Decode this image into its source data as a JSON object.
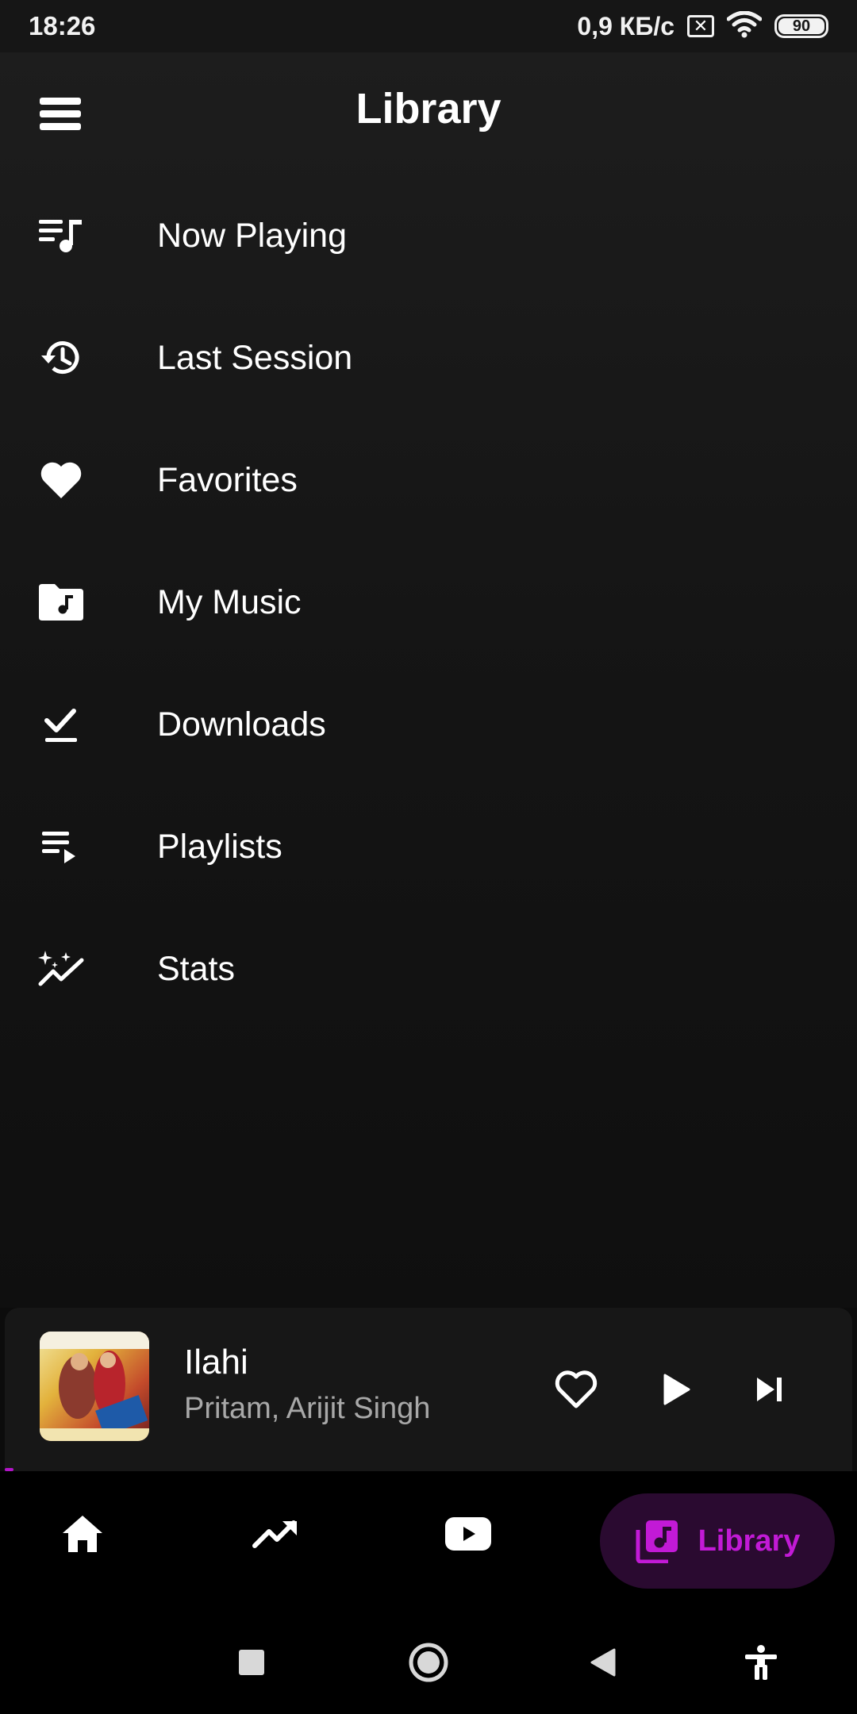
{
  "status_bar": {
    "time": "18:26",
    "network_speed": "0,9 КБ/с",
    "sim_icon": "sim-off-icon",
    "wifi_icon": "wifi-icon",
    "battery_level": "90"
  },
  "header": {
    "title": "Library",
    "menu_icon": "menu-icon"
  },
  "menu": {
    "items": [
      {
        "label": "Now Playing",
        "icon": "queue-music-icon"
      },
      {
        "label": "Last Session",
        "icon": "history-icon"
      },
      {
        "label": "Favorites",
        "icon": "heart-icon"
      },
      {
        "label": "My Music",
        "icon": "music-folder-icon"
      },
      {
        "label": "Downloads",
        "icon": "download-done-icon"
      },
      {
        "label": "Playlists",
        "icon": "playlist-play-icon"
      },
      {
        "label": "Stats",
        "icon": "auto-graph-icon"
      }
    ]
  },
  "player": {
    "title": "Ilahi",
    "artist": "Pritam, Arijit Singh",
    "progress_fraction": 0.01,
    "accent_color": "#b214c8"
  },
  "bottom_nav": {
    "items": [
      {
        "name": "home",
        "icon": "home-icon"
      },
      {
        "name": "trending",
        "icon": "trending-up-icon"
      },
      {
        "name": "youtube",
        "icon": "youtube-icon"
      },
      {
        "name": "library",
        "icon": "library-music-icon",
        "label": "Library",
        "selected": true
      }
    ],
    "accent_color": "#c21ad6",
    "selected_bg": "#2a0a30"
  },
  "system_nav": {
    "items": [
      "recents-icon",
      "home-circle-icon",
      "back-icon",
      "accessibility-icon"
    ]
  }
}
